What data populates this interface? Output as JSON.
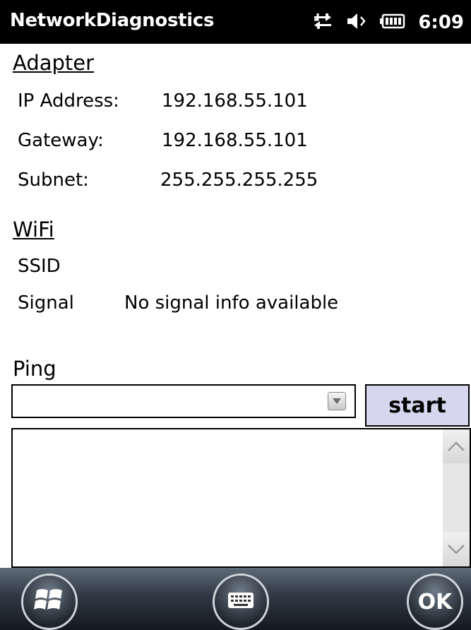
{
  "titlebar": {
    "title": "NetworkDiagnostics",
    "clock": "6:09",
    "icons": [
      "data-sync-icon",
      "speaker-muted-icon",
      "battery-icon"
    ]
  },
  "adapter": {
    "heading": "Adapter",
    "ip_label": "IP Address:",
    "ip_value": "192.168.55.101",
    "gateway_label": "Gateway:",
    "gateway_value": "192.168.55.101",
    "subnet_label": "Subnet:",
    "subnet_value": "255.255.255.255"
  },
  "wifi": {
    "heading": "WiFi",
    "ssid_label": "SSID",
    "ssid_value": "",
    "signal_label": "Signal",
    "signal_value": "No signal info available"
  },
  "ping": {
    "label": "Ping",
    "host_value": "",
    "start_label": "start",
    "output_text": ""
  },
  "softkeys": {
    "ok_label": "OK",
    "icons": [
      "windows-start-icon",
      "keyboard-icon"
    ]
  },
  "colors": {
    "titlebar_bg": "#000000",
    "button_bg": "#d6d6ee",
    "bottombar_bg": "#2f3945"
  }
}
